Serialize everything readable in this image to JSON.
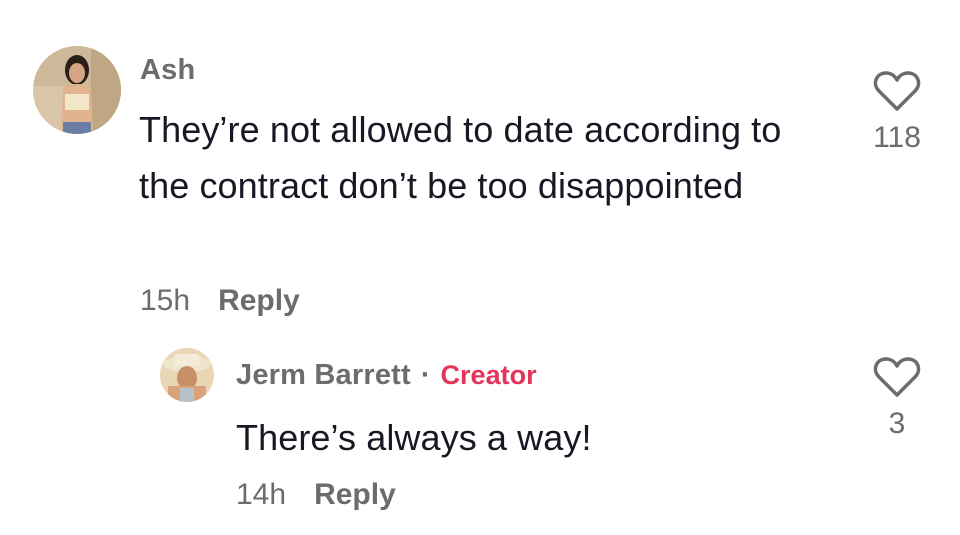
{
  "comment": {
    "username": "Ash",
    "text": "They’re not allowed to date according to the contract don’t be too disappointed",
    "time": "15h",
    "reply_label": "Reply",
    "like_count": "118",
    "like_icon": "heart-outline-icon"
  },
  "reply": {
    "username": "Jerm Barrett",
    "separator": "·",
    "badge": "Creator",
    "text": "There’s always a way!",
    "time": "14h",
    "reply_label": "Reply",
    "like_count": "3",
    "like_icon": "heart-outline-icon"
  },
  "colors": {
    "text": "#161823",
    "secondary": "#6b6b70",
    "creator_badge": "#e4345a",
    "background": "#ffffff"
  }
}
